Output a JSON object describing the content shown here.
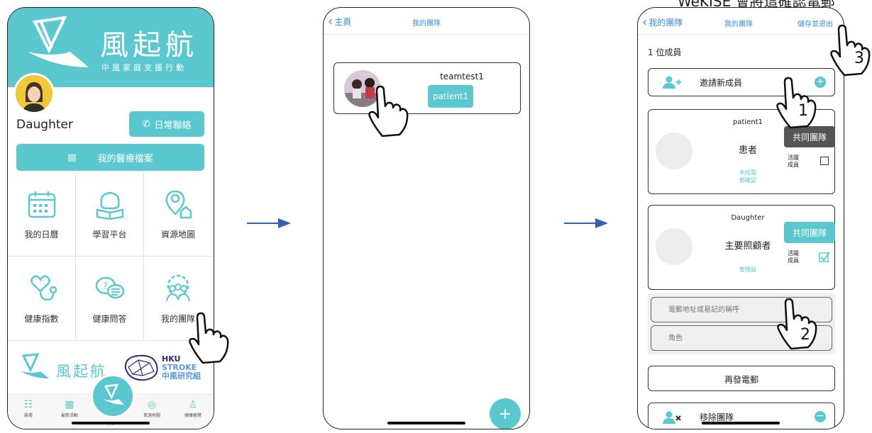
{
  "top_caption": "WeKISE 會將這確認電郵",
  "colors": {
    "accent": "#5bc8cf",
    "link": "#3b8fd4",
    "dark_pill": "#555555"
  },
  "phone1": {
    "brand_name": "風起航",
    "brand_sub": "中風家庭支援行動",
    "user_name": "Daughter",
    "contact_button": "日常聯絡",
    "records_button": "我的醫療檔案",
    "grid": [
      {
        "label": "我的日曆",
        "icon": "calendar-icon"
      },
      {
        "label": "學習平台",
        "icon": "brain-book-icon"
      },
      {
        "label": "資源地圖",
        "icon": "map-pin-home-icon"
      },
      {
        "label": "健康指數",
        "icon": "stethoscope-heart-icon"
      },
      {
        "label": "健康問答",
        "icon": "qa-bubbles-icon"
      },
      {
        "label": "我的團隊",
        "icon": "team-gear-icon"
      }
    ],
    "logo_text": "風起航",
    "partner_logo": {
      "line1": "HKU",
      "line2": "STROKE",
      "line3": "中風研究組"
    },
    "tabs": [
      {
        "label": "論壇",
        "icon": "forum-icon"
      },
      {
        "label": "最新活動",
        "icon": "activity-icon"
      },
      {
        "label": "主頁",
        "icon": "home-logo-icon"
      },
      {
        "label": "資源地圖",
        "icon": "map-icon"
      },
      {
        "label": "健康概覽",
        "icon": "person-icon"
      }
    ]
  },
  "phone2": {
    "back_label": "主頁",
    "title": "我的團隊",
    "team_name": "teamtest1",
    "team_member_pill": "patient1",
    "fab_symbol": "+"
  },
  "phone3": {
    "back_label": "我的團隊",
    "title": "我的團隊",
    "save_label": "儲存並退出",
    "member_count": "1 位成員",
    "invite_label": "邀請新成員",
    "members": [
      {
        "name": "patient1",
        "role": "患者",
        "status_line1": "未經電",
        "status_line2": "郵確認",
        "pill": "共同團隊",
        "active_line1": "活躍",
        "active_line2": "成員",
        "checked": false
      },
      {
        "name": "Daughter",
        "role": "主要照顧者",
        "status_line1": "管理員",
        "status_line2": "",
        "pill": "共同團隊",
        "active_line1": "活躍",
        "active_line2": "成員",
        "checked": true
      }
    ],
    "email_placeholder": "電郵地址或易記的稱呼",
    "role_placeholder": "角色",
    "resend_label": "再發電郵",
    "remove_label": "移除團隊"
  },
  "steps": [
    "1",
    "2",
    "3"
  ]
}
